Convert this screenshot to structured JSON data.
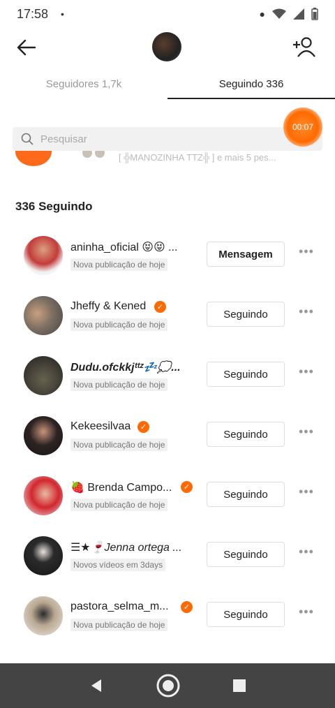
{
  "status_bar": {
    "time": "17:58",
    "dot": "•"
  },
  "header": {
    "back_icon": "arrow-left-icon",
    "add_user_icon": "add-person-icon"
  },
  "tabs": [
    {
      "label": "Seguidores 1,7k",
      "active": false
    },
    {
      "label": "Seguindo 336",
      "active": true
    }
  ],
  "timer": {
    "label": "00:07"
  },
  "search": {
    "placeholder": "Pesquisar"
  },
  "peek": {
    "text": "[ ╬MANOZINHA TTZ╬ ] e mais 5 pes..."
  },
  "section": {
    "title": "336 Seguindo"
  },
  "accent_color": "#ff6a00",
  "following": [
    {
      "name": "aninha_oficial 😝😝 ...",
      "verified": false,
      "subtitle": "Nova publicação de hoje",
      "button": "Mensagem",
      "avatar_color": "#c43b3b"
    },
    {
      "name": "Jheffy & Kened",
      "verified": true,
      "subtitle": "Nova publicação de hoje",
      "button": "Seguindo",
      "avatar_color": "#7d6f63"
    },
    {
      "name": "Dudu.ofckkjᵗᵗᶻ💤💭...",
      "verified": false,
      "subtitle": "Nova publicação de hoje",
      "button": "Seguindo",
      "avatar_color": "#3e3a33"
    },
    {
      "name": "Kekeesilvaa",
      "verified": true,
      "subtitle": "Nova publicação de hoje",
      "button": "Seguindo",
      "avatar_color": "#2d2323"
    },
    {
      "name": "🍓 Brenda Campo...",
      "verified": true,
      "subtitle": "Nova publicação de hoje",
      "button": "Seguindo",
      "avatar_color": "#d2262e"
    },
    {
      "name": "☰★🍷Jenna ortega ...",
      "verified": false,
      "subtitle": "Novos vídeos em 3days",
      "button": "Seguindo",
      "avatar_color": "#2b2b2b"
    },
    {
      "name": "pastora_selma_m...",
      "verified": true,
      "subtitle": "Nova publicação de hoje",
      "button": "Seguindo",
      "avatar_color": "#b9a892"
    }
  ],
  "nav": {
    "back": "triangle-back-icon",
    "home": "circle-home-icon",
    "recents": "square-recents-icon"
  }
}
